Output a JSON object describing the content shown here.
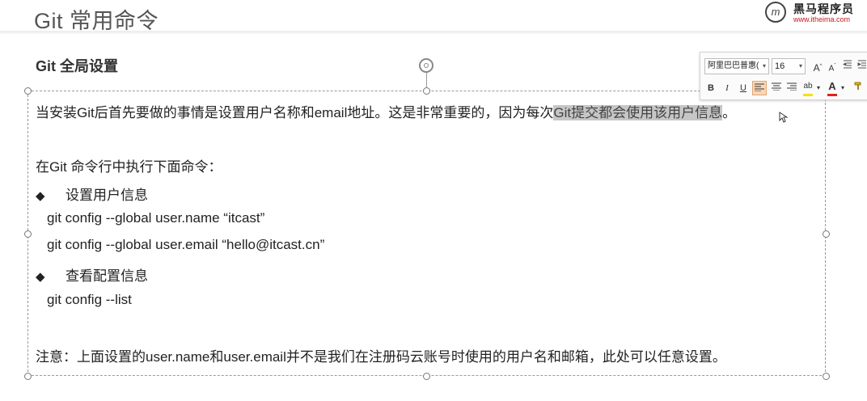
{
  "slide": {
    "title": "Git 常用命令",
    "section_heading": "Git 全局设置"
  },
  "logo": {
    "name": "黑马程序员",
    "url": "www.itheima.com"
  },
  "content": {
    "intro_prefix": "当安装Git后首先要做的事情是设置用户名称和email地址。这是非常重要的，因为每次",
    "intro_highlight": "Git提交都会使用该用户信息",
    "intro_suffix": "。",
    "instruction": "在Git 命令行中执行下面命令：",
    "bullet_symbol": "◆",
    "bullet1": "设置用户信息",
    "cmd1": "git config --global user.name  “itcast”",
    "cmd2": "git config --global user.email  “hello@itcast.cn”",
    "bullet2": "查看配置信息",
    "cmd3": "git config --list",
    "note": "注意：上面设置的user.name和user.email并不是我们在注册码云账号时使用的用户名和邮箱，此处可以任意设置。"
  },
  "mini_toolbar": {
    "font_name": "阿里巴巴普惠(",
    "font_size": "16",
    "bold_label": "B",
    "italic_label": "I",
    "underline_label": "U",
    "grow_font_label": "A",
    "shrink_font_label": "A",
    "font_color_label": "A",
    "highlight_label": "ab",
    "highlight_color": "#f5e100",
    "font_color": "#e0231c"
  }
}
